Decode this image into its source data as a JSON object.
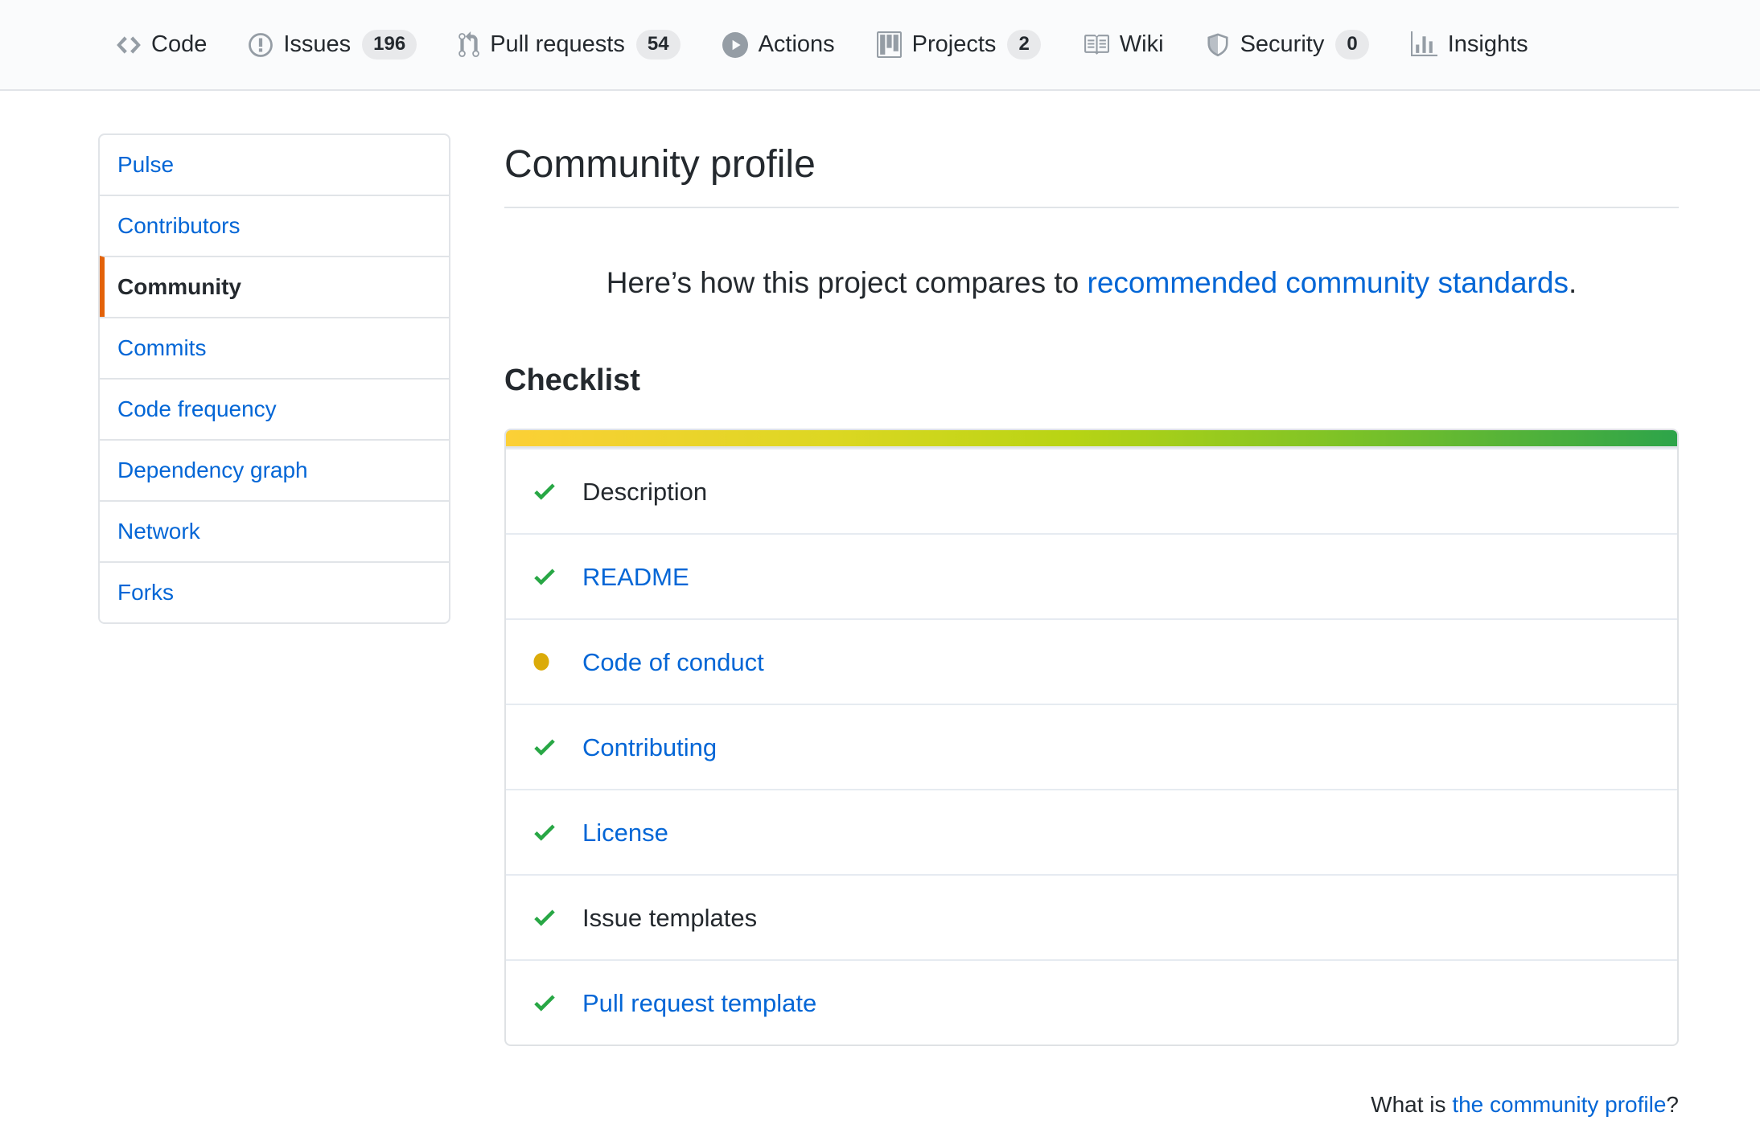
{
  "colors": {
    "link_blue": "#0366d6",
    "success_green": "#28a745",
    "pending_yellow": "#dbab09",
    "active_orange": "#e36209",
    "nav_background": "#fafbfc",
    "border_gray": "#e1e4e8",
    "meter_gradient": [
      "#fcd036",
      "#b8d414",
      "#7cc227",
      "#2da44a"
    ]
  },
  "nav": {
    "items": [
      {
        "label": "Code"
      },
      {
        "label": "Issues",
        "count": "196"
      },
      {
        "label": "Pull requests",
        "count": "54"
      },
      {
        "label": "Actions"
      },
      {
        "label": "Projects",
        "count": "2"
      },
      {
        "label": "Wiki"
      },
      {
        "label": "Security",
        "count": "0"
      },
      {
        "label": "Insights"
      }
    ]
  },
  "sidebar": {
    "items": [
      {
        "label": "Pulse",
        "active": false
      },
      {
        "label": "Contributors",
        "active": false
      },
      {
        "label": "Community",
        "active": true
      },
      {
        "label": "Commits",
        "active": false
      },
      {
        "label": "Code frequency",
        "active": false
      },
      {
        "label": "Dependency graph",
        "active": false
      },
      {
        "label": "Network",
        "active": false
      },
      {
        "label": "Forks",
        "active": false
      }
    ]
  },
  "main": {
    "title": "Community profile",
    "intro": {
      "prefix": "Here’s how this project compares to ",
      "link_text": "recommended community standards",
      "suffix": "."
    },
    "checklist_heading": "Checklist",
    "checklist": [
      {
        "label": "Description",
        "status": "complete",
        "is_link": false
      },
      {
        "label": "README",
        "status": "complete",
        "is_link": true
      },
      {
        "label": "Code of conduct",
        "status": "pending",
        "is_link": true
      },
      {
        "label": "Contributing",
        "status": "complete",
        "is_link": true
      },
      {
        "label": "License",
        "status": "complete",
        "is_link": true
      },
      {
        "label": "Issue templates",
        "status": "complete",
        "is_link": false
      },
      {
        "label": "Pull request template",
        "status": "complete",
        "is_link": true
      }
    ],
    "footer": {
      "prefix": "What is ",
      "link_text": "the community profile",
      "suffix": "?"
    }
  }
}
